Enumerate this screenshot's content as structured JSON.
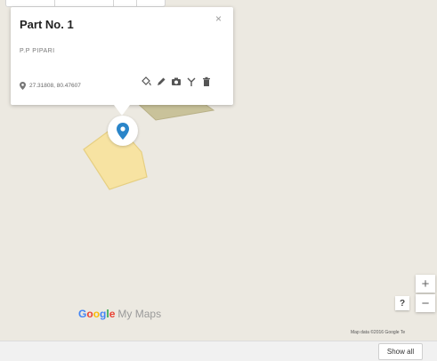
{
  "info_window": {
    "title": "Part No. 1",
    "close_label": "×",
    "description": "P.P PIPARI",
    "coordinates": "27.31808, 80.47607",
    "actions": [
      "paint-bucket-icon",
      "pencil-icon",
      "camera-icon",
      "route-icon",
      "trash-icon"
    ]
  },
  "branding": {
    "google": "Google",
    "my_maps": "My Maps"
  },
  "map_controls": {
    "zoom_in": "+",
    "zoom_out": "−",
    "help": "?"
  },
  "attribution": "Map data ©2016 Google   Te",
  "footer": {
    "show_all": "Show all"
  },
  "colors": {
    "map_background": "#ece9e1",
    "polygon_yellow": "#f7e3a2",
    "polygon_yellow_stroke": "#e6cf82",
    "polygon_olive": "#c9c29a",
    "marker_blue": "#2a85c9"
  }
}
